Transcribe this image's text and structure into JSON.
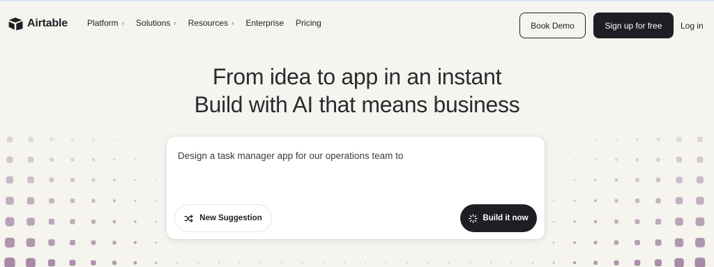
{
  "brand": {
    "name": "Airtable"
  },
  "nav": {
    "items": [
      {
        "label": "Platform",
        "has_chevron": true
      },
      {
        "label": "Solutions",
        "has_chevron": true
      },
      {
        "label": "Resources",
        "has_chevron": true
      },
      {
        "label": "Enterprise",
        "has_chevron": false
      },
      {
        "label": "Pricing",
        "has_chevron": false
      }
    ],
    "chevron_glyph": "›"
  },
  "actions": {
    "book_demo": "Book Demo",
    "sign_up": "Sign up for free",
    "log_in": "Log in"
  },
  "hero": {
    "line1": "From idea to app in an instant",
    "line2": "Build with AI that means business"
  },
  "prompt": {
    "text": "Design a task manager app for our operations team to",
    "new_suggestion": "New Suggestion",
    "build_now": "Build it now"
  },
  "icons": {
    "logo": "airtable-logo-icon",
    "shuffle": "shuffle-icon",
    "loading": "spinner-icon"
  },
  "colors": {
    "background": "#f5f4ee",
    "dark": "#1d1f25",
    "dot_light": "#e2dfe2",
    "dot_accent": "#a88aa6"
  }
}
